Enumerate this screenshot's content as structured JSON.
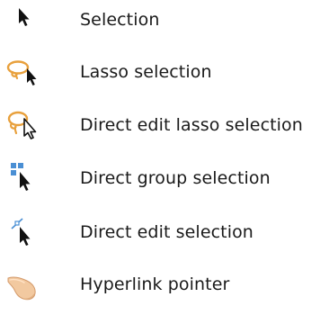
{
  "tools": [
    {
      "label": "Selection",
      "icon": "selection-arrow-icon"
    },
    {
      "label": "Lasso selection",
      "icon": "lasso-selection-icon"
    },
    {
      "label": "Direct edit lasso selection",
      "icon": "direct-edit-lasso-icon"
    },
    {
      "label": "Direct group selection",
      "icon": "direct-group-selection-icon"
    },
    {
      "label": "Direct edit selection",
      "icon": "direct-edit-selection-icon"
    },
    {
      "label": "Hyperlink pointer",
      "icon": "hyperlink-pointer-icon"
    }
  ],
  "colors": {
    "text": "#1a1a1a",
    "cursor": "#111111",
    "lasso": "#e8a03c",
    "group_square": "#4a8fd4",
    "hand": "#f2c9a0"
  }
}
